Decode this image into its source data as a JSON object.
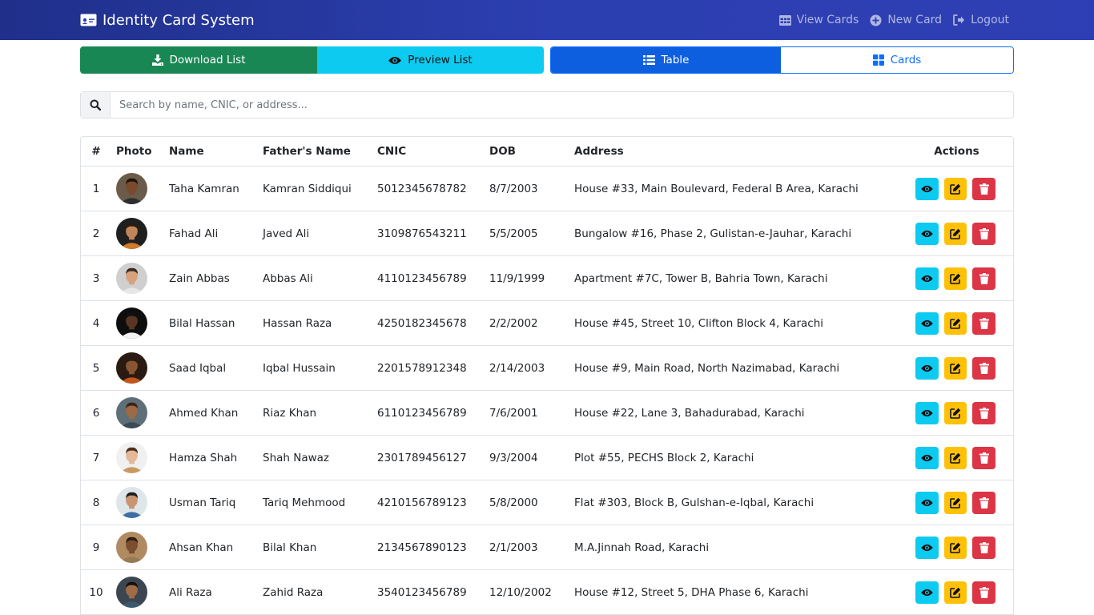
{
  "app": {
    "title": "Identity Card System",
    "nav": [
      {
        "label": "View Cards",
        "icon": "table-icon"
      },
      {
        "label": "New Card",
        "icon": "plus-circle-icon"
      },
      {
        "label": "Logout",
        "icon": "logout-icon"
      }
    ]
  },
  "toolbar": {
    "download_label": "Download List",
    "preview_label": "Preview List",
    "table_label": "Table",
    "cards_label": "Cards"
  },
  "search": {
    "placeholder": "Search by name, CNIC, or address...",
    "value": ""
  },
  "table": {
    "headers": [
      "#",
      "Photo",
      "Name",
      "Father's Name",
      "CNIC",
      "DOB",
      "Address",
      "Actions"
    ],
    "rows": [
      {
        "num": "1",
        "name": "Taha Kamran",
        "father": "Kamran Siddiqui",
        "cnic": "5012345678782",
        "dob": "8/7/2003",
        "address": "House #33, Main Boulevard, Federal B Area, Karachi"
      },
      {
        "num": "2",
        "name": "Fahad Ali",
        "father": "Javed Ali",
        "cnic": "3109876543211",
        "dob": "5/5/2005",
        "address": "Bungalow #16, Phase 2, Gulistan-e-Jauhar, Karachi"
      },
      {
        "num": "3",
        "name": "Zain Abbas",
        "father": "Abbas Ali",
        "cnic": "4110123456789",
        "dob": "11/9/1999",
        "address": "Apartment #7C, Tower B, Bahria Town, Karachi"
      },
      {
        "num": "4",
        "name": "Bilal Hassan",
        "father": "Hassan Raza",
        "cnic": "4250182345678",
        "dob": "2/2/2002",
        "address": "House #45, Street 10, Clifton Block 4, Karachi"
      },
      {
        "num": "5",
        "name": "Saad Iqbal",
        "father": "Iqbal Hussain",
        "cnic": "2201578912348",
        "dob": "2/14/2003",
        "address": "House #9, Main Road, North Nazimabad, Karachi"
      },
      {
        "num": "6",
        "name": "Ahmed Khan",
        "father": "Riaz Khan",
        "cnic": "6110123456789",
        "dob": "7/6/2001",
        "address": "House #22, Lane 3, Bahadurabad, Karachi"
      },
      {
        "num": "7",
        "name": "Hamza Shah",
        "father": "Shah Nawaz",
        "cnic": "2301789456127",
        "dob": "9/3/2004",
        "address": "Plot #55, PECHS Block 2, Karachi"
      },
      {
        "num": "8",
        "name": "Usman Tariq",
        "father": "Tariq Mehmood",
        "cnic": "4210156789123",
        "dob": "5/8/2000",
        "address": "Flat #303, Block B, Gulshan-e-Iqbal, Karachi"
      },
      {
        "num": "9",
        "name": "Ahsan Khan",
        "father": "Bilal Khan",
        "cnic": "2134567890123",
        "dob": "2/1/2003",
        "address": "M.A.Jinnah Road, Karachi"
      },
      {
        "num": "10",
        "name": "Ali Raza",
        "father": "Zahid Raza",
        "cnic": "3540123456789",
        "dob": "12/10/2002",
        "address": "House #12, Street 5, DHA Phase 6, Karachi"
      }
    ]
  },
  "colors": {
    "navbar": "#2c3fb0",
    "download": "#198754",
    "preview": "#0dcaf0",
    "primary": "#0d6efd",
    "view": "#0dcaf0",
    "edit": "#ffc107",
    "delete": "#dc3545"
  }
}
